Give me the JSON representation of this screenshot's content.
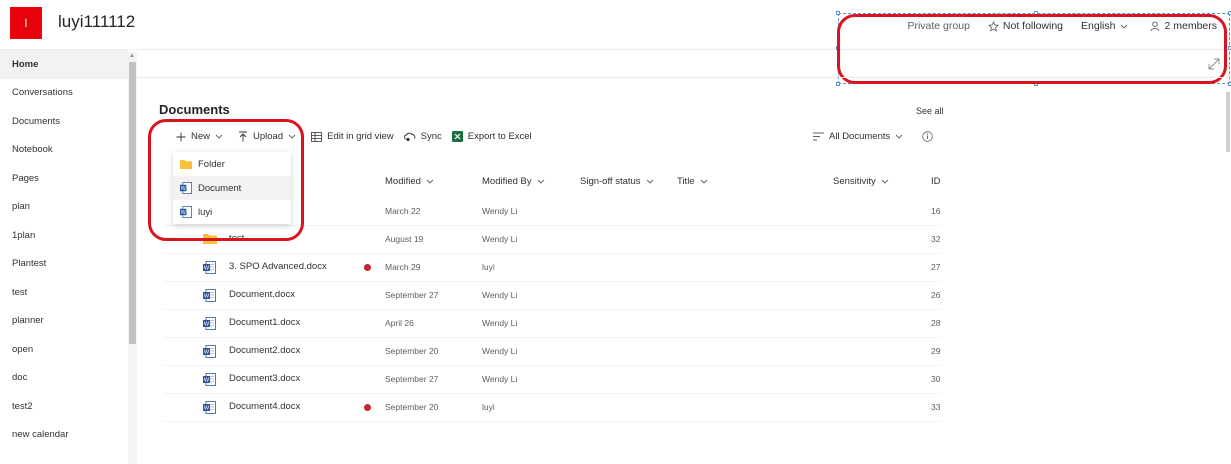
{
  "site": {
    "logo_letter": "l",
    "title": "luyi111112",
    "privacy": "Private group",
    "follow_label": "Not following",
    "language": "English",
    "members": "2 members",
    "accent": "#e8000b"
  },
  "nav": {
    "items": [
      {
        "label": "Home",
        "active": true
      },
      {
        "label": "Conversations"
      },
      {
        "label": "Documents"
      },
      {
        "label": "Notebook"
      },
      {
        "label": "Pages"
      },
      {
        "label": "plan"
      },
      {
        "label": "1plan"
      },
      {
        "label": "Plantest"
      },
      {
        "label": "test"
      },
      {
        "label": "planner"
      },
      {
        "label": "open"
      },
      {
        "label": "doc"
      },
      {
        "label": "test2"
      },
      {
        "label": "new calendar"
      }
    ]
  },
  "documents": {
    "title": "Documents",
    "see_all": "See all",
    "toolbar": {
      "new": "New",
      "upload": "Upload",
      "grid": "Edit in grid view",
      "sync": "Sync",
      "excel": "Export to Excel",
      "view": "All Documents"
    },
    "new_menu": [
      {
        "label": "Folder",
        "icon": "folder-icon"
      },
      {
        "label": "Document",
        "icon": "word-icon"
      },
      {
        "label": "luyi",
        "icon": "word-icon"
      }
    ],
    "columns": {
      "modified": "Modified",
      "modified_by": "Modified By",
      "signoff": "Sign-off status",
      "title": "Title",
      "sensitivity": "Sensitivity",
      "id": "ID"
    },
    "rows": [
      {
        "name": "",
        "type": "folder",
        "modified": "March 22",
        "by": "Wendy Li",
        "id": "16",
        "flag": false
      },
      {
        "name": "test",
        "type": "folder",
        "modified": "August 19",
        "by": "Wendy Li",
        "id": "32",
        "flag": false
      },
      {
        "name": "3. SPO Advanced.docx",
        "type": "word",
        "modified": "March 29",
        "by": "luyi",
        "id": "27",
        "flag": true
      },
      {
        "name": "Document.docx",
        "type": "word",
        "modified": "September 27",
        "by": "Wendy Li",
        "id": "26",
        "flag": false
      },
      {
        "name": "Document1.docx",
        "type": "word",
        "modified": "April 26",
        "by": "Wendy Li",
        "id": "28",
        "flag": false
      },
      {
        "name": "Document2.docx",
        "type": "word",
        "modified": "September 20",
        "by": "Wendy Li",
        "id": "29",
        "flag": false
      },
      {
        "name": "Document3.docx",
        "type": "word",
        "modified": "September 27",
        "by": "Wendy Li",
        "id": "30",
        "flag": false
      },
      {
        "name": "Document4.docx",
        "type": "word",
        "modified": "September 20",
        "by": "luyi",
        "id": "33",
        "flag": true
      }
    ]
  }
}
